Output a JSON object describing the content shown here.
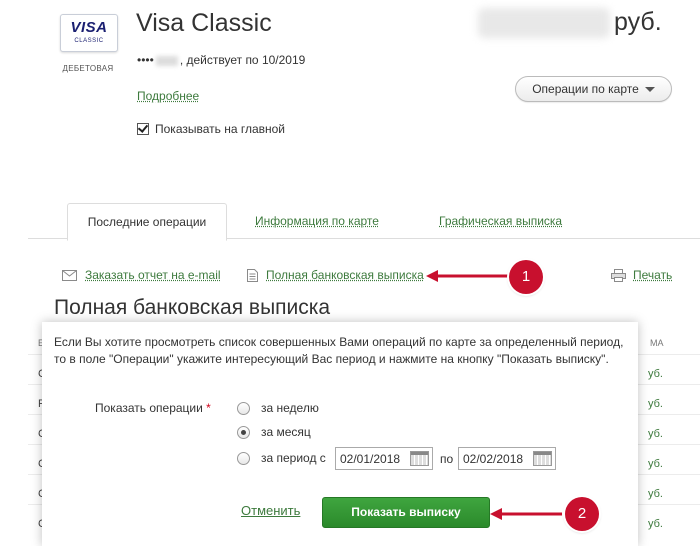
{
  "card": {
    "brand": "VISA",
    "brand_sub": "CLASSIC",
    "type": "ДЕБЕТОВАЯ",
    "title": "Visa Classic",
    "currency": "руб.",
    "number_prefix": "••••",
    "validity": ", действует по 10/2019",
    "details_link": "Подробнее",
    "show_on_main": "Показывать на главной"
  },
  "operations_button": "Операции по карте",
  "tabs": [
    {
      "label": "Последние операции",
      "active": true
    },
    {
      "label": "Информация по карте",
      "active": false
    },
    {
      "label": "Графическая выписка",
      "active": false
    }
  ],
  "actions": {
    "email_report": "Заказать отчет на e-mail",
    "full_statement": "Полная банковская выписка",
    "print": "Печать"
  },
  "background_table": {
    "header_left": "Е",
    "header_right": "МА",
    "rows": [
      {
        "left": "С",
        "right": "уб."
      },
      {
        "left": "Р",
        "right": "уб."
      },
      {
        "left": "С",
        "right": "уб."
      },
      {
        "left": "С",
        "right": "уб."
      },
      {
        "left": "С",
        "right": "уб."
      },
      {
        "left": "С",
        "right": "уб."
      }
    ]
  },
  "modal": {
    "title": "Полная банковская выписка",
    "description": "Если Вы хотите просмотреть список совершенных Вами операций по карте за определенный период, то в поле \"Операции\" укажите интересующий Вас период и нажмите на кнопку \"Показать выписку\".",
    "show_ops_label": "Показать операции",
    "required_mark": "*",
    "options": [
      {
        "label": "за неделю",
        "selected": false
      },
      {
        "label": "за месяц",
        "selected": true
      },
      {
        "label": "за период с",
        "selected": false
      }
    ],
    "date_from": "02/01/2018",
    "date_to_label": "по",
    "date_to": "02/02/2018",
    "cancel": "Отменить",
    "submit": "Показать выписку"
  },
  "callouts": [
    "1",
    "2"
  ],
  "colors": {
    "link_green": "#3d7a3d",
    "button_green": "#2b8a2b",
    "callout_red": "#c8102e"
  },
  "icons": {
    "email": "envelope-icon",
    "statement": "document-icon",
    "print": "printer-icon",
    "calendar": "calendar-icon"
  }
}
